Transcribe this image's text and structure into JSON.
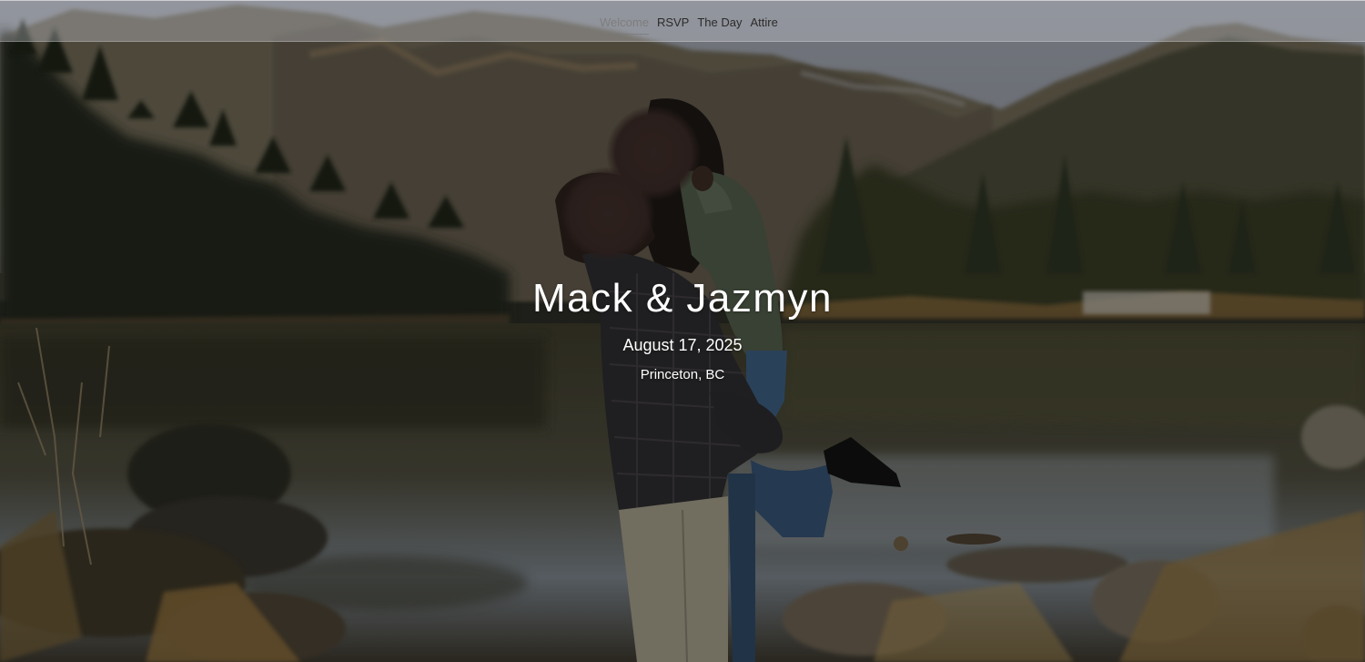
{
  "nav": {
    "items": [
      {
        "label": "Welcome",
        "active": true
      },
      {
        "label": "RSVP",
        "active": false
      },
      {
        "label": "The Day",
        "active": false
      },
      {
        "label": "Attire",
        "active": false
      }
    ]
  },
  "hero": {
    "title": "Mack & Jazmyn",
    "date": "August 17, 2025",
    "location": "Princeton, BC"
  },
  "colors": {
    "text": "#ffffff",
    "nav_text": "#2b2b2b",
    "nav_active_text": "#7d7d7d"
  }
}
